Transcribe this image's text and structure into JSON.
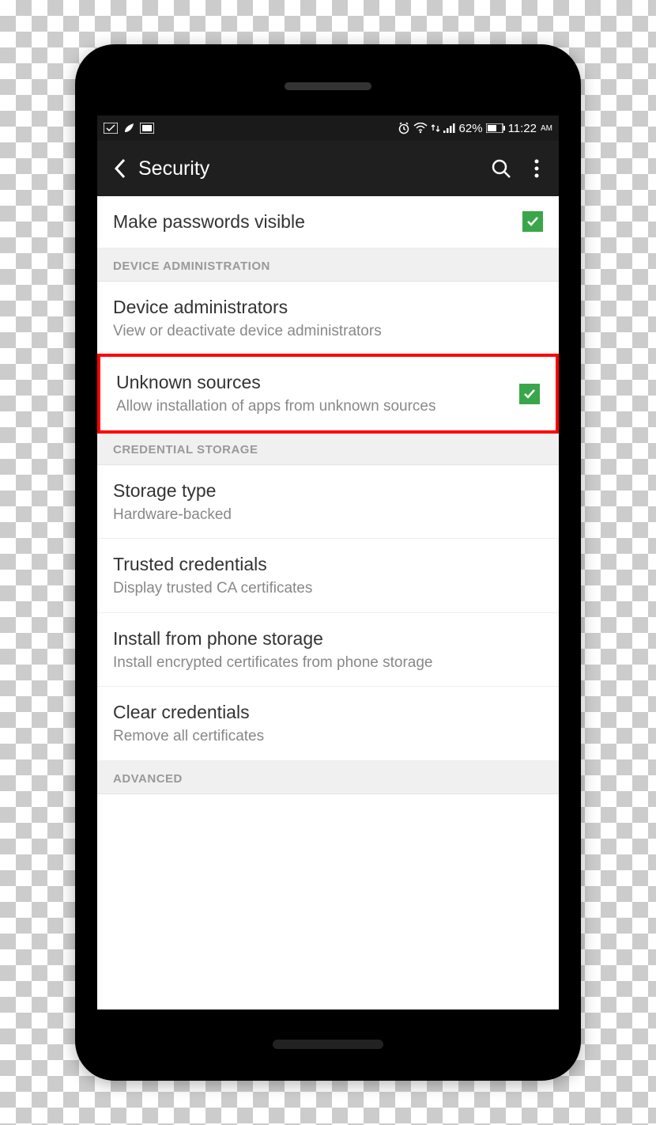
{
  "statusbar": {
    "battery_text": "62%",
    "time": "11:22",
    "ampm": "AM"
  },
  "appbar": {
    "title": "Security"
  },
  "rows": {
    "passwords": {
      "title": "Make passwords visible"
    }
  },
  "sections": {
    "device_admin": {
      "header": "DEVICE ADMINISTRATION",
      "admins": {
        "title": "Device administrators",
        "sub": "View or deactivate device administrators"
      },
      "unknown": {
        "title": "Unknown sources",
        "sub": "Allow installation of apps from unknown sources"
      }
    },
    "credential": {
      "header": "CREDENTIAL STORAGE",
      "storage_type": {
        "title": "Storage type",
        "sub": "Hardware-backed"
      },
      "trusted": {
        "title": "Trusted credentials",
        "sub": "Display trusted CA certificates"
      },
      "install": {
        "title": "Install from phone storage",
        "sub": "Install encrypted certificates from phone storage"
      },
      "clear": {
        "title": "Clear credentials",
        "sub": "Remove all certificates"
      }
    },
    "advanced": {
      "header": "ADVANCED"
    }
  }
}
